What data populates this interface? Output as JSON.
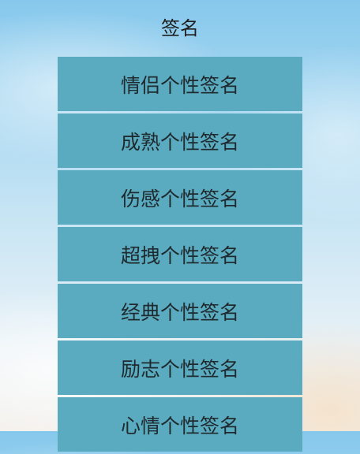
{
  "header": {
    "title": "签名"
  },
  "menu": {
    "items": [
      {
        "label": "情侣个性签名"
      },
      {
        "label": "成熟个性签名"
      },
      {
        "label": "伤感个性签名"
      },
      {
        "label": "超拽个性签名"
      },
      {
        "label": "经典个性签名"
      },
      {
        "label": "励志个性签名"
      },
      {
        "label": "心情个性签名"
      }
    ]
  },
  "colors": {
    "item_background": "#5aabbf",
    "item_text": "#1f2a2f",
    "title_text": "#1e1e1e"
  }
}
